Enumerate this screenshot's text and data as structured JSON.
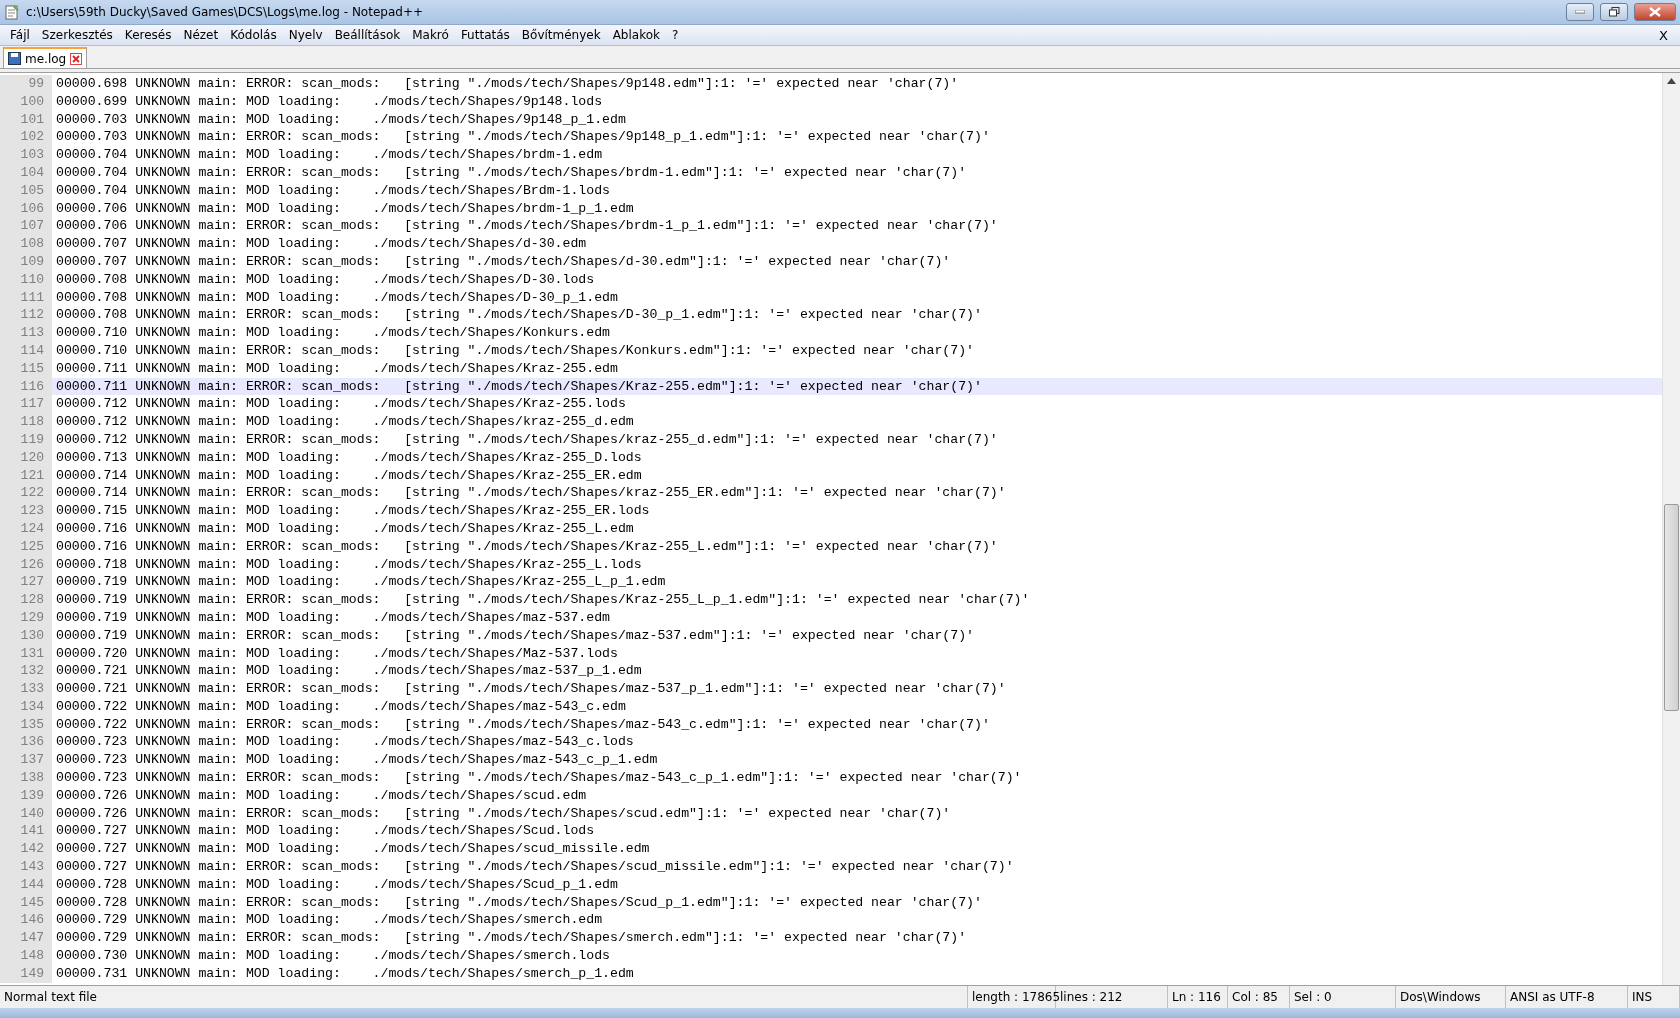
{
  "window": {
    "title": "c:\\Users\\59th Ducky\\Saved Games\\DCS\\Logs\\me.log - Notepad++"
  },
  "menu": [
    "Fájl",
    "Szerkesztés",
    "Keresés",
    "Nézet",
    "Kódolás",
    "Nyelv",
    "Beállítások",
    "Makró",
    "Futtatás",
    "Bővítmények",
    "Ablakok",
    "?"
  ],
  "menu_close": "X",
  "tabs": [
    {
      "label": "me.log",
      "selected": true
    }
  ],
  "editor": {
    "lines": [
      {
        "number": "99",
        "text": "00000.698 UNKNOWN main: ERROR: scan_mods:   [string \"./mods/tech/Shapes/9p148.edm\"]:1: '=' expected near 'char(7)'",
        "current": false
      },
      {
        "number": "100",
        "text": "00000.699 UNKNOWN main: MOD loading:    ./mods/tech/Shapes/9p148.lods",
        "current": false
      },
      {
        "number": "101",
        "text": "00000.703 UNKNOWN main: MOD loading:    ./mods/tech/Shapes/9p148_p_1.edm",
        "current": false
      },
      {
        "number": "102",
        "text": "00000.703 UNKNOWN main: ERROR: scan_mods:   [string \"./mods/tech/Shapes/9p148_p_1.edm\"]:1: '=' expected near 'char(7)'",
        "current": false
      },
      {
        "number": "103",
        "text": "00000.704 UNKNOWN main: MOD loading:    ./mods/tech/Shapes/brdm-1.edm",
        "current": false
      },
      {
        "number": "104",
        "text": "00000.704 UNKNOWN main: ERROR: scan_mods:   [string \"./mods/tech/Shapes/brdm-1.edm\"]:1: '=' expected near 'char(7)'",
        "current": false
      },
      {
        "number": "105",
        "text": "00000.704 UNKNOWN main: MOD loading:    ./mods/tech/Shapes/Brdm-1.lods",
        "current": false
      },
      {
        "number": "106",
        "text": "00000.706 UNKNOWN main: MOD loading:    ./mods/tech/Shapes/brdm-1_p_1.edm",
        "current": false
      },
      {
        "number": "107",
        "text": "00000.706 UNKNOWN main: ERROR: scan_mods:   [string \"./mods/tech/Shapes/brdm-1_p_1.edm\"]:1: '=' expected near 'char(7)'",
        "current": false
      },
      {
        "number": "108",
        "text": "00000.707 UNKNOWN main: MOD loading:    ./mods/tech/Shapes/d-30.edm",
        "current": false
      },
      {
        "number": "109",
        "text": "00000.707 UNKNOWN main: ERROR: scan_mods:   [string \"./mods/tech/Shapes/d-30.edm\"]:1: '=' expected near 'char(7)'",
        "current": false
      },
      {
        "number": "110",
        "text": "00000.708 UNKNOWN main: MOD loading:    ./mods/tech/Shapes/D-30.lods",
        "current": false
      },
      {
        "number": "111",
        "text": "00000.708 UNKNOWN main: MOD loading:    ./mods/tech/Shapes/D-30_p_1.edm",
        "current": false
      },
      {
        "number": "112",
        "text": "00000.708 UNKNOWN main: ERROR: scan_mods:   [string \"./mods/tech/Shapes/D-30_p_1.edm\"]:1: '=' expected near 'char(7)'",
        "current": false
      },
      {
        "number": "113",
        "text": "00000.710 UNKNOWN main: MOD loading:    ./mods/tech/Shapes/Konkurs.edm",
        "current": false
      },
      {
        "number": "114",
        "text": "00000.710 UNKNOWN main: ERROR: scan_mods:   [string \"./mods/tech/Shapes/Konkurs.edm\"]:1: '=' expected near 'char(7)'",
        "current": false
      },
      {
        "number": "115",
        "text": "00000.711 UNKNOWN main: MOD loading:    ./mods/tech/Shapes/Kraz-255.edm",
        "current": false
      },
      {
        "number": "116",
        "text": "00000.711 UNKNOWN main: ERROR: scan_mods:   [string \"./mods/tech/Shapes/Kraz-255.edm\"]:1: '=' expected near 'char(7)'",
        "current": true
      },
      {
        "number": "117",
        "text": "00000.712 UNKNOWN main: MOD loading:    ./mods/tech/Shapes/Kraz-255.lods",
        "current": false
      },
      {
        "number": "118",
        "text": "00000.712 UNKNOWN main: MOD loading:    ./mods/tech/Shapes/kraz-255_d.edm",
        "current": false
      },
      {
        "number": "119",
        "text": "00000.712 UNKNOWN main: ERROR: scan_mods:   [string \"./mods/tech/Shapes/kraz-255_d.edm\"]:1: '=' expected near 'char(7)'",
        "current": false
      },
      {
        "number": "120",
        "text": "00000.713 UNKNOWN main: MOD loading:    ./mods/tech/Shapes/Kraz-255_D.lods",
        "current": false
      },
      {
        "number": "121",
        "text": "00000.714 UNKNOWN main: MOD loading:    ./mods/tech/Shapes/Kraz-255_ER.edm",
        "current": false
      },
      {
        "number": "122",
        "text": "00000.714 UNKNOWN main: ERROR: scan_mods:   [string \"./mods/tech/Shapes/kraz-255_ER.edm\"]:1: '=' expected near 'char(7)'",
        "current": false
      },
      {
        "number": "123",
        "text": "00000.715 UNKNOWN main: MOD loading:    ./mods/tech/Shapes/Kraz-255_ER.lods",
        "current": false
      },
      {
        "number": "124",
        "text": "00000.716 UNKNOWN main: MOD loading:    ./mods/tech/Shapes/Kraz-255_L.edm",
        "current": false
      },
      {
        "number": "125",
        "text": "00000.716 UNKNOWN main: ERROR: scan_mods:   [string \"./mods/tech/Shapes/Kraz-255_L.edm\"]:1: '=' expected near 'char(7)'",
        "current": false
      },
      {
        "number": "126",
        "text": "00000.718 UNKNOWN main: MOD loading:    ./mods/tech/Shapes/Kraz-255_L.lods",
        "current": false
      },
      {
        "number": "127",
        "text": "00000.719 UNKNOWN main: MOD loading:    ./mods/tech/Shapes/Kraz-255_L_p_1.edm",
        "current": false
      },
      {
        "number": "128",
        "text": "00000.719 UNKNOWN main: ERROR: scan_mods:   [string \"./mods/tech/Shapes/Kraz-255_L_p_1.edm\"]:1: '=' expected near 'char(7)'",
        "current": false
      },
      {
        "number": "129",
        "text": "00000.719 UNKNOWN main: MOD loading:    ./mods/tech/Shapes/maz-537.edm",
        "current": false
      },
      {
        "number": "130",
        "text": "00000.719 UNKNOWN main: ERROR: scan_mods:   [string \"./mods/tech/Shapes/maz-537.edm\"]:1: '=' expected near 'char(7)'",
        "current": false
      },
      {
        "number": "131",
        "text": "00000.720 UNKNOWN main: MOD loading:    ./mods/tech/Shapes/Maz-537.lods",
        "current": false
      },
      {
        "number": "132",
        "text": "00000.721 UNKNOWN main: MOD loading:    ./mods/tech/Shapes/maz-537_p_1.edm",
        "current": false
      },
      {
        "number": "133",
        "text": "00000.721 UNKNOWN main: ERROR: scan_mods:   [string \"./mods/tech/Shapes/maz-537_p_1.edm\"]:1: '=' expected near 'char(7)'",
        "current": false
      },
      {
        "number": "134",
        "text": "00000.722 UNKNOWN main: MOD loading:    ./mods/tech/Shapes/maz-543_c.edm",
        "current": false
      },
      {
        "number": "135",
        "text": "00000.722 UNKNOWN main: ERROR: scan_mods:   [string \"./mods/tech/Shapes/maz-543_c.edm\"]:1: '=' expected near 'char(7)'",
        "current": false
      },
      {
        "number": "136",
        "text": "00000.723 UNKNOWN main: MOD loading:    ./mods/tech/Shapes/maz-543_c.lods",
        "current": false
      },
      {
        "number": "137",
        "text": "00000.723 UNKNOWN main: MOD loading:    ./mods/tech/Shapes/maz-543_c_p_1.edm",
        "current": false
      },
      {
        "number": "138",
        "text": "00000.723 UNKNOWN main: ERROR: scan_mods:   [string \"./mods/tech/Shapes/maz-543_c_p_1.edm\"]:1: '=' expected near 'char(7)'",
        "current": false
      },
      {
        "number": "139",
        "text": "00000.726 UNKNOWN main: MOD loading:    ./mods/tech/Shapes/scud.edm",
        "current": false
      },
      {
        "number": "140",
        "text": "00000.726 UNKNOWN main: ERROR: scan_mods:   [string \"./mods/tech/Shapes/scud.edm\"]:1: '=' expected near 'char(7)'",
        "current": false
      },
      {
        "number": "141",
        "text": "00000.727 UNKNOWN main: MOD loading:    ./mods/tech/Shapes/Scud.lods",
        "current": false
      },
      {
        "number": "142",
        "text": "00000.727 UNKNOWN main: MOD loading:    ./mods/tech/Shapes/scud_missile.edm",
        "current": false
      },
      {
        "number": "143",
        "text": "00000.727 UNKNOWN main: ERROR: scan_mods:   [string \"./mods/tech/Shapes/scud_missile.edm\"]:1: '=' expected near 'char(7)'",
        "current": false
      },
      {
        "number": "144",
        "text": "00000.728 UNKNOWN main: MOD loading:    ./mods/tech/Shapes/Scud_p_1.edm",
        "current": false
      },
      {
        "number": "145",
        "text": "00000.728 UNKNOWN main: ERROR: scan_mods:   [string \"./mods/tech/Shapes/Scud_p_1.edm\"]:1: '=' expected near 'char(7)'",
        "current": false
      },
      {
        "number": "146",
        "text": "00000.729 UNKNOWN main: MOD loading:    ./mods/tech/Shapes/smerch.edm",
        "current": false
      },
      {
        "number": "147",
        "text": "00000.729 UNKNOWN main: ERROR: scan_mods:   [string \"./mods/tech/Shapes/smerch.edm\"]:1: '=' expected near 'char(7)'",
        "current": false
      },
      {
        "number": "148",
        "text": "00000.730 UNKNOWN main: MOD loading:    ./mods/tech/Shapes/smerch.lods",
        "current": false
      },
      {
        "number": "149",
        "text": "00000.731 UNKNOWN main: MOD loading:    ./mods/tech/Shapes/smerch_p_1.edm",
        "current": false
      }
    ]
  },
  "status_bar": {
    "file_type": "Normal text file",
    "length": "length : 17865",
    "lines": "lines : 212",
    "ln": "Ln : 116",
    "col": "Col : 85",
    "sel": "Sel : 0",
    "eol": "Dos\\Windows",
    "encoding": "ANSI as UTF-8",
    "mode": "INS"
  }
}
